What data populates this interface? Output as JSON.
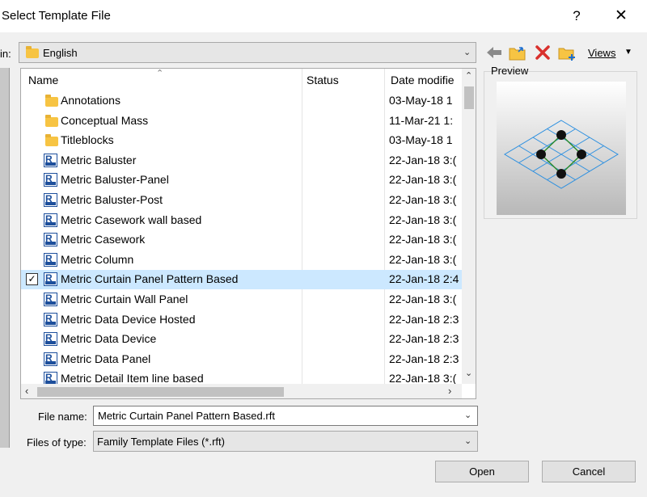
{
  "window": {
    "title": "Select Template File",
    "help_glyph": "?",
    "close_glyph": "✕"
  },
  "look_in": {
    "label": "in:",
    "value": "English"
  },
  "toolbar": {
    "views_label": "Views"
  },
  "columns": {
    "name": "Name",
    "status": "Status",
    "date": "Date modifie"
  },
  "files": [
    {
      "name": "Annotations",
      "date": "03-May-18 1",
      "type": "folder"
    },
    {
      "name": "Conceptual Mass",
      "date": "11-Mar-21 1:",
      "type": "folder"
    },
    {
      "name": "Titleblocks",
      "date": "03-May-18 1",
      "type": "folder"
    },
    {
      "name": "Metric Baluster",
      "date": "22-Jan-18 3:(",
      "type": "rft"
    },
    {
      "name": "Metric Baluster-Panel",
      "date": "22-Jan-18 3:(",
      "type": "rft"
    },
    {
      "name": "Metric Baluster-Post",
      "date": "22-Jan-18 3:(",
      "type": "rft"
    },
    {
      "name": "Metric Casework wall based",
      "date": "22-Jan-18 3:(",
      "type": "rft"
    },
    {
      "name": "Metric Casework",
      "date": "22-Jan-18 3:(",
      "type": "rft"
    },
    {
      "name": "Metric Column",
      "date": "22-Jan-18 3:(",
      "type": "rft"
    },
    {
      "name": "Metric Curtain Panel Pattern Based",
      "date": "22-Jan-18 2:4",
      "type": "rft",
      "selected": true
    },
    {
      "name": "Metric Curtain Wall Panel",
      "date": "22-Jan-18 3:(",
      "type": "rft"
    },
    {
      "name": "Metric Data Device Hosted",
      "date": "22-Jan-18 2:3",
      "type": "rft"
    },
    {
      "name": "Metric Data Device",
      "date": "22-Jan-18 2:3",
      "type": "rft"
    },
    {
      "name": "Metric Data Panel",
      "date": "22-Jan-18 2:3",
      "type": "rft"
    },
    {
      "name": "Metric Detail Item line based",
      "date": "22-Jan-18 3:(",
      "type": "rft"
    }
  ],
  "preview": {
    "label": "Preview"
  },
  "file_name": {
    "label": "File name:",
    "value": "Metric Curtain Panel Pattern Based.rft"
  },
  "file_type": {
    "label": "Files of type:",
    "value": "Family Template Files  (*.rft)"
  },
  "buttons": {
    "open": "Open",
    "cancel": "Cancel"
  },
  "colors": {
    "selection": "#cce8ff",
    "folder": "#f7c443",
    "rft_icon": "#1d4f9c",
    "delete_red": "#d9302c"
  }
}
